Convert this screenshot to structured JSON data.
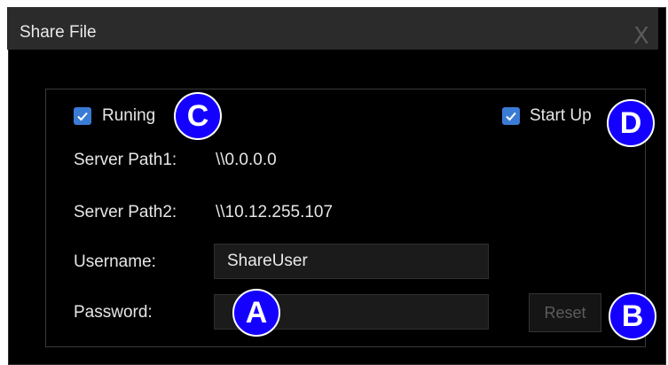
{
  "window": {
    "title": "Share File",
    "close_glyph": "X"
  },
  "options": {
    "running": {
      "label": "Runing",
      "checked": true
    },
    "startup": {
      "label": "Start Up",
      "checked": true
    }
  },
  "server": {
    "path1_label": "Server Path1:",
    "path1_value": "\\\\0.0.0.0",
    "path2_label": "Server Path2:",
    "path2_value": "\\\\10.12.255.107"
  },
  "credentials": {
    "username_label": "Username:",
    "username_value": "ShareUser",
    "password_label": "Password:",
    "password_value": ""
  },
  "reset_label": "Reset",
  "annotations": {
    "a": "A",
    "b": "B",
    "c": "C",
    "d": "D"
  },
  "colors": {
    "accent": "#3a7bd5",
    "annotation": "#1400ff",
    "background": "#000000"
  },
  "icons": {
    "checkbox": "checkmark-icon"
  }
}
